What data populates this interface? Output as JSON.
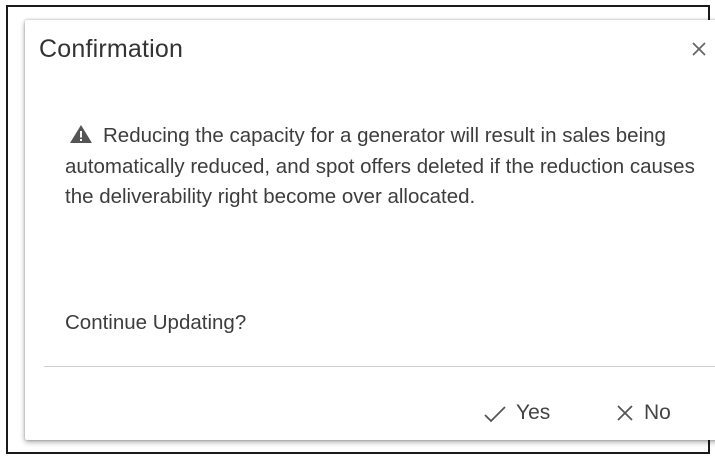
{
  "dialog": {
    "title": "Confirmation",
    "close_icon": "close-icon",
    "warning_icon": "warning-triangle-icon",
    "message": "Reducing the capacity for a generator will result in sales being automatically reduced, and spot offers deleted if the reduction causes the deliverability right become over allocated.",
    "question": "Continue Updating?",
    "buttons": {
      "yes": {
        "label": "Yes",
        "icon": "check-icon"
      },
      "no": {
        "label": "No",
        "icon": "close-icon"
      }
    }
  },
  "colors": {
    "text": "#3d3d3d",
    "title": "#333333",
    "icon": "#555555",
    "divider": "#cfcfcf"
  }
}
